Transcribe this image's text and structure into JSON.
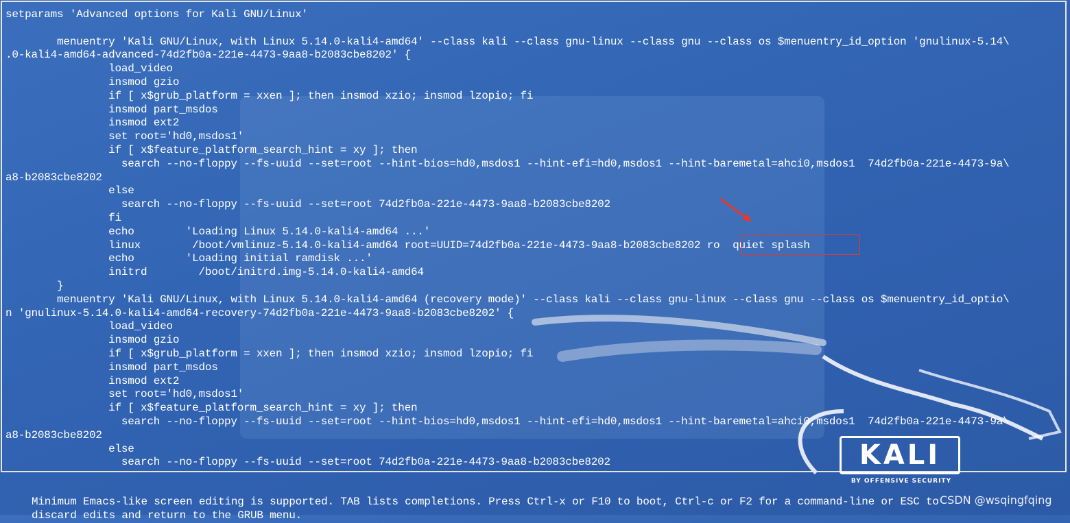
{
  "editor": {
    "lines": [
      "setparams 'Advanced options for Kali GNU/Linux'",
      "",
      "        menuentry 'Kali GNU/Linux, with Linux 5.14.0-kali4-amd64' --class kali --class gnu-linux --class gnu --class os $menuentry_id_option 'gnulinux-5.14\\",
      ".0-kali4-amd64-advanced-74d2fb0a-221e-4473-9aa8-b2083cbe8202' {",
      "                load_video",
      "                insmod gzio",
      "                if [ x$grub_platform = xxen ]; then insmod xzio; insmod lzopio; fi",
      "                insmod part_msdos",
      "                insmod ext2",
      "                set root='hd0,msdos1'",
      "                if [ x$feature_platform_search_hint = xy ]; then",
      "                  search --no-floppy --fs-uuid --set=root --hint-bios=hd0,msdos1 --hint-efi=hd0,msdos1 --hint-baremetal=ahci0,msdos1  74d2fb0a-221e-4473-9a\\",
      "a8-b2083cbe8202",
      "                else",
      "                  search --no-floppy --fs-uuid --set=root 74d2fb0a-221e-4473-9aa8-b2083cbe8202",
      "                fi",
      "                echo        'Loading Linux 5.14.0-kali4-amd64 ...'",
      "                linux        /boot/vmlinuz-5.14.0-kali4-amd64 root=UUID=74d2fb0a-221e-4473-9aa8-b2083cbe8202 ro  quiet splash",
      "                echo        'Loading initial ramdisk ...'",
      "                initrd        /boot/initrd.img-5.14.0-kali4-amd64",
      "        }",
      "        menuentry 'Kali GNU/Linux, with Linux 5.14.0-kali4-amd64 (recovery mode)' --class kali --class gnu-linux --class gnu --class os $menuentry_id_optio\\",
      "n 'gnulinux-5.14.0-kali4-amd64-recovery-74d2fb0a-221e-4473-9aa8-b2083cbe8202' {",
      "                load_video",
      "                insmod gzio",
      "                if [ x$grub_platform = xxen ]; then insmod xzio; insmod lzopio; fi",
      "                insmod part_msdos",
      "                insmod ext2",
      "                set root='hd0,msdos1'",
      "                if [ x$feature_platform_search_hint = xy ]; then",
      "                  search --no-floppy --fs-uuid --set=root --hint-bios=hd0,msdos1 --hint-efi=hd0,msdos1 --hint-baremetal=ahci0,msdos1  74d2fb0a-221e-4473-9a\\",
      "a8-b2083cbe8202",
      "                else",
      "                  search --no-floppy --fs-uuid --set=root 74d2fb0a-221e-4473-9aa8-b2083cbe8202"
    ]
  },
  "help_text": {
    "line1": "Minimum Emacs-like screen editing is supported. TAB lists completions. Press Ctrl-x or F10 to boot, Ctrl-c or F2 for a command-line or ESC to",
    "line2": "discard edits and return to the GRUB menu."
  },
  "branding": {
    "logo_text": "KALI",
    "logo_subtitle": "BY OFFENSIVE SECURITY"
  },
  "watermark": "CSDN @wsqingfqing",
  "colors": {
    "background": "#3265b4",
    "text": "#ffffff",
    "highlight_border": "#e03b2e",
    "editor_border": "#e6e6e6"
  }
}
